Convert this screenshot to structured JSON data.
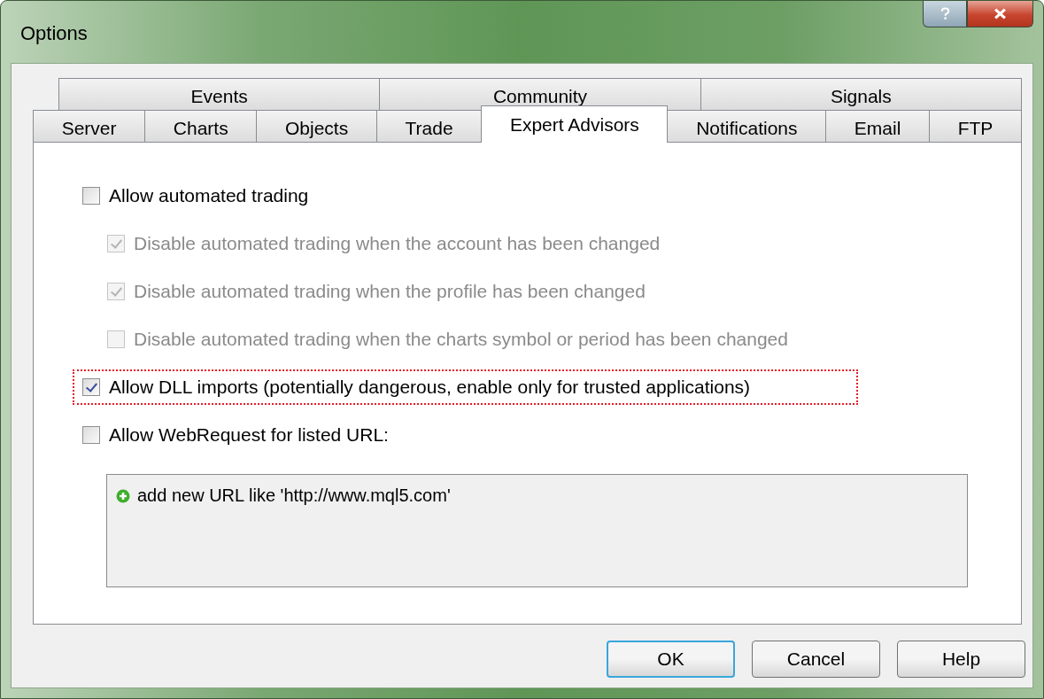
{
  "window": {
    "title": "Options"
  },
  "tab_rows": [
    [
      {
        "label": "Events",
        "selected": false
      },
      {
        "label": "Community",
        "selected": false
      },
      {
        "label": "Signals",
        "selected": false
      }
    ],
    [
      {
        "label": "Server",
        "selected": false
      },
      {
        "label": "Charts",
        "selected": false
      },
      {
        "label": "Objects",
        "selected": false
      },
      {
        "label": "Trade",
        "selected": false
      },
      {
        "label": "Expert Advisors",
        "selected": true
      },
      {
        "label": "Notifications",
        "selected": false
      },
      {
        "label": "Email",
        "selected": false
      },
      {
        "label": "FTP",
        "selected": false
      }
    ]
  ],
  "options": [
    {
      "label": "Allow automated trading",
      "checked": false,
      "disabled": false,
      "focused": false,
      "children": [
        {
          "label": "Disable automated trading when the account has been changed",
          "checked": true,
          "disabled": true,
          "focused": false
        },
        {
          "label": "Disable automated trading when the profile has been changed",
          "checked": true,
          "disabled": true,
          "focused": false
        },
        {
          "label": "Disable automated trading when the charts symbol or period has been changed",
          "checked": false,
          "disabled": true,
          "focused": false
        }
      ]
    },
    {
      "label": "Allow DLL imports (potentially dangerous, enable only for trusted applications)",
      "checked": true,
      "disabled": false,
      "focused": true
    },
    {
      "label": "Allow WebRequest for listed URL:",
      "checked": false,
      "disabled": false,
      "focused": false
    }
  ],
  "url_list": {
    "add_item": "add new URL like 'http://www.mql5.com'"
  },
  "buttons": [
    {
      "label": "OK",
      "default": true
    },
    {
      "label": "Cancel",
      "default": false
    },
    {
      "label": "Help",
      "default": false
    }
  ]
}
